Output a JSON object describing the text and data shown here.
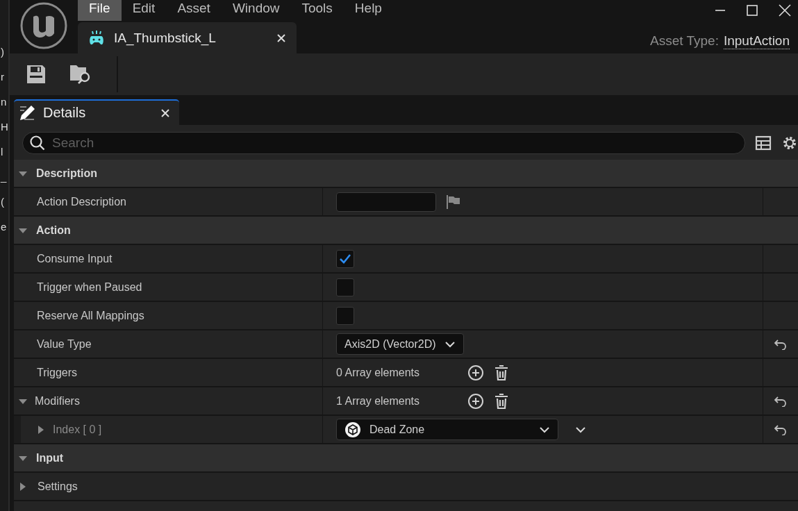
{
  "background_window": {
    "fragments": [
      ")",
      "r",
      "n",
      "H",
      "l",
      "_",
      "(",
      "e"
    ]
  },
  "menu": [
    {
      "label": "File",
      "selected": true
    },
    {
      "label": "Edit",
      "selected": false
    },
    {
      "label": "Asset",
      "selected": false
    },
    {
      "label": "Window",
      "selected": false
    },
    {
      "label": "Tools",
      "selected": false
    },
    {
      "label": "Help",
      "selected": false
    }
  ],
  "document_tab": {
    "title": "IA_Thumbstick_L"
  },
  "asset_type": {
    "label": "Asset Type:",
    "value": "InputAction"
  },
  "panel_tab": {
    "title": "Details"
  },
  "search": {
    "placeholder": "Search"
  },
  "sections": [
    {
      "title": "Description",
      "expanded": true,
      "rows": [
        {
          "kind": "text",
          "label": "Action Description",
          "resettable": false
        }
      ]
    },
    {
      "title": "Action",
      "expanded": true,
      "rows": [
        {
          "kind": "checkbox",
          "label": "Consume Input",
          "checked": true,
          "resettable": false
        },
        {
          "kind": "checkbox",
          "label": "Trigger when Paused",
          "checked": false,
          "resettable": false
        },
        {
          "kind": "checkbox",
          "label": "Reserve All Mappings",
          "checked": false,
          "resettable": false
        },
        {
          "kind": "dropdown",
          "label": "Value Type",
          "value": "Axis2D (Vector2D)",
          "resettable": true
        },
        {
          "kind": "array",
          "label": "Triggers",
          "count": "0 Array elements",
          "resettable": false
        },
        {
          "kind": "array",
          "label": "Modifiers",
          "count": "1 Array elements",
          "resettable": true,
          "expanded": true,
          "children": [
            {
              "kind": "item",
              "label": "Index [ 0 ]",
              "value": "Dead Zone",
              "resettable": true,
              "expanded": false
            }
          ]
        }
      ]
    },
    {
      "title": "Input",
      "expanded": true,
      "rows": [
        {
          "kind": "group",
          "label": "Settings",
          "expanded": false
        }
      ]
    }
  ]
}
